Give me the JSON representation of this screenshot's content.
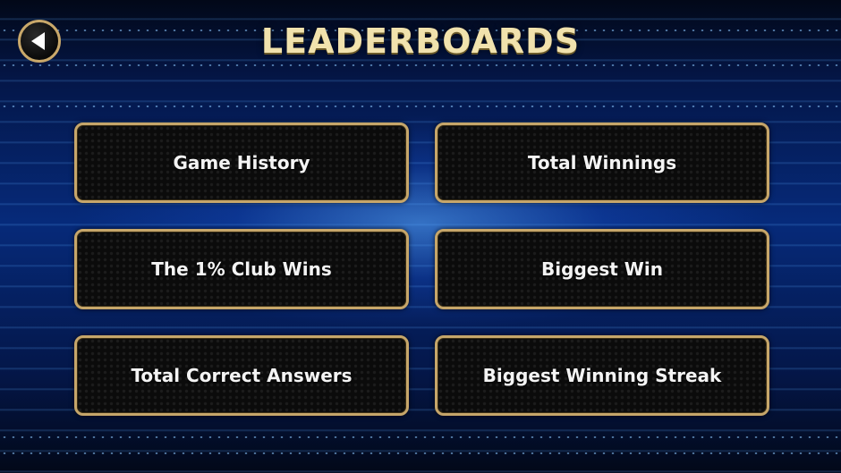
{
  "header": {
    "title": "LEADERBOARDS",
    "back_icon": "back-arrow-icon"
  },
  "menu": {
    "items": [
      {
        "label": "Game History"
      },
      {
        "label": "Total Winnings"
      },
      {
        "label": "The 1% Club Wins"
      },
      {
        "label": "Biggest Win"
      },
      {
        "label": "Total Correct Answers"
      },
      {
        "label": "Biggest Winning Streak"
      }
    ]
  },
  "colors": {
    "accent_gold": "#c6a66a",
    "title_cream": "#f1e2ad",
    "background_blue": "#062a7a"
  }
}
